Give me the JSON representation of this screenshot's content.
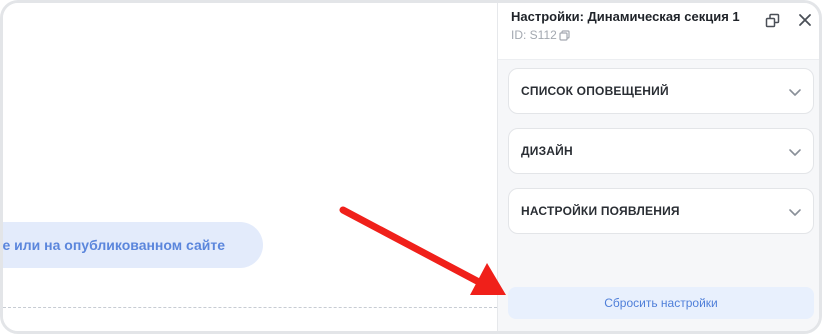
{
  "canvas": {
    "preview_text": "е или на опубликованном сайте"
  },
  "panel": {
    "title": "Настройки: Динамическая секция 1",
    "id_text": "ID: S112",
    "icons": {
      "copy": "copy-icon",
      "detach": "detach-window-icon",
      "close": "close-icon"
    },
    "sections": [
      {
        "label": "СПИСОК ОПОВЕЩЕНИЙ",
        "icon": "chevron-down-icon"
      },
      {
        "label": "ДИЗАЙН",
        "icon": "chevron-down-icon"
      },
      {
        "label": "НАСТРОЙКИ ПОЯВЛЕНИЯ",
        "icon": "chevron-down-icon"
      }
    ],
    "reset_label": "Сбросить настройки"
  },
  "annotation": {
    "arrow_color": "#f0201a",
    "icon": "red-arrow-icon"
  },
  "colors": {
    "accent": "#4f7fd9",
    "pill_bg": "#e3ebfb",
    "panel_bg": "#f6f7f9"
  }
}
